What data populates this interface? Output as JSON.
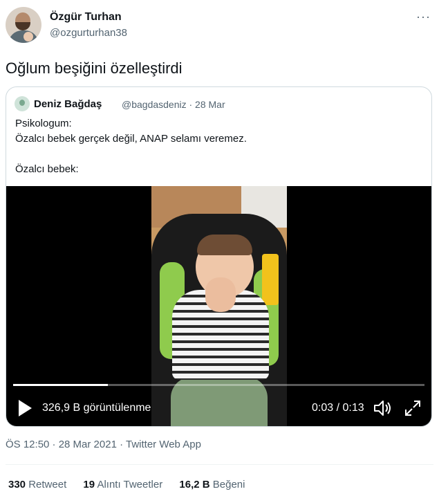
{
  "author": {
    "name": "Özgür Turhan",
    "handle": "@ozgurturhan38"
  },
  "more_icon": "more-dots-icon",
  "tweet": {
    "text": "Oğlum beşiğini özelleştirdi"
  },
  "quoted": {
    "name": "Deniz Bağdaş",
    "handle_date": "@bagdasdeniz · 28 Mar",
    "lines": [
      "Psikologum:",
      "Özalcı bebek gerçek değil, ANAP selamı veremez.",
      "",
      "Özalcı bebek:"
    ]
  },
  "video": {
    "views": "326,9 B görüntülenme",
    "time": "0:03 / 0:13",
    "progress": 0.23,
    "icons": [
      "play-icon",
      "volume-icon",
      "fullscreen-icon"
    ]
  },
  "meta": {
    "timestamp": "ÖS 12:50 · 28 Mar 2021 · Twitter Web App"
  },
  "stats": {
    "retweets_count": "330",
    "retweets_label": "Retweet",
    "quotes_count": "19",
    "quotes_label": "Alıntı Tweetler",
    "likes_count": "16,2 B",
    "likes_label": "Beğeni"
  },
  "colors": {
    "text": "#0f1419",
    "secondary": "#536471",
    "border": "#cfd9de"
  }
}
